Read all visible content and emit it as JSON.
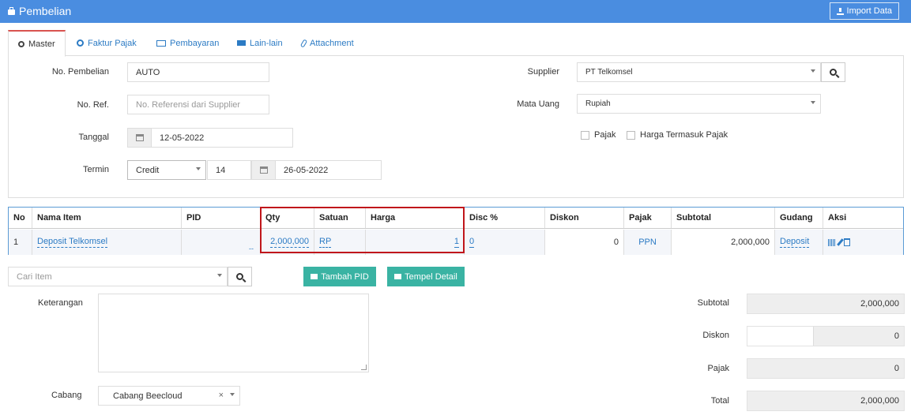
{
  "header": {
    "title": "Pembelian",
    "import_label": "Import Data"
  },
  "tabs": [
    {
      "label": "Master"
    },
    {
      "label": "Faktur Pajak"
    },
    {
      "label": "Pembayaran"
    },
    {
      "label": "Lain-lain"
    },
    {
      "label": "Attachment"
    }
  ],
  "form": {
    "no_pembelian_label": "No. Pembelian",
    "no_pembelian_value": "AUTO",
    "no_ref_label": "No. Ref.",
    "no_ref_placeholder": "No. Referensi dari Supplier",
    "tanggal_label": "Tanggal",
    "tanggal_value": "12-05-2022",
    "termin_label": "Termin",
    "termin_type": "Credit",
    "termin_days": "14",
    "termin_date": "26-05-2022",
    "supplier_label": "Supplier",
    "supplier_value": "PT Telkomsel",
    "mata_uang_label": "Mata Uang",
    "mata_uang_value": "Rupiah",
    "pajak_label": "Pajak",
    "harga_termasuk_pajak_label": "Harga Termasuk Pajak"
  },
  "grid": {
    "columns": [
      "No",
      "Nama Item",
      "PID",
      "Qty",
      "Satuan",
      "Harga",
      "Disc %",
      "Diskon",
      "Pajak",
      "Subtotal",
      "Gudang",
      "Aksi"
    ],
    "rows": [
      {
        "no": "1",
        "nama_item": "Deposit Telkomsel",
        "pid": "--",
        "qty": "2,000,000",
        "satuan": "RP",
        "harga": "1",
        "disc_pct": "0",
        "diskon": "0",
        "pajak": "PPN",
        "subtotal": "2,000,000",
        "gudang": "Deposit"
      }
    ]
  },
  "item_search": {
    "placeholder": "Cari Item"
  },
  "buttons": {
    "tambah_pid": "Tambah PID",
    "tempel_detail": "Tempel Detail"
  },
  "keterangan_label": "Keterangan",
  "cabang": {
    "label": "Cabang",
    "value": "Cabang Beecloud"
  },
  "summary": {
    "subtotal_label": "Subtotal",
    "subtotal_value": "2,000,000",
    "diskon_label": "Diskon",
    "diskon_value": "0",
    "pajak_label": "Pajak",
    "pajak_value": "0",
    "total_label": "Total",
    "total_value": "2,000,000"
  },
  "colors": {
    "header_blue": "#4a8de0",
    "accent_teal": "#3ab3a3",
    "highlight_red": "#c0161b",
    "link_blue": "#2c7bc4"
  }
}
